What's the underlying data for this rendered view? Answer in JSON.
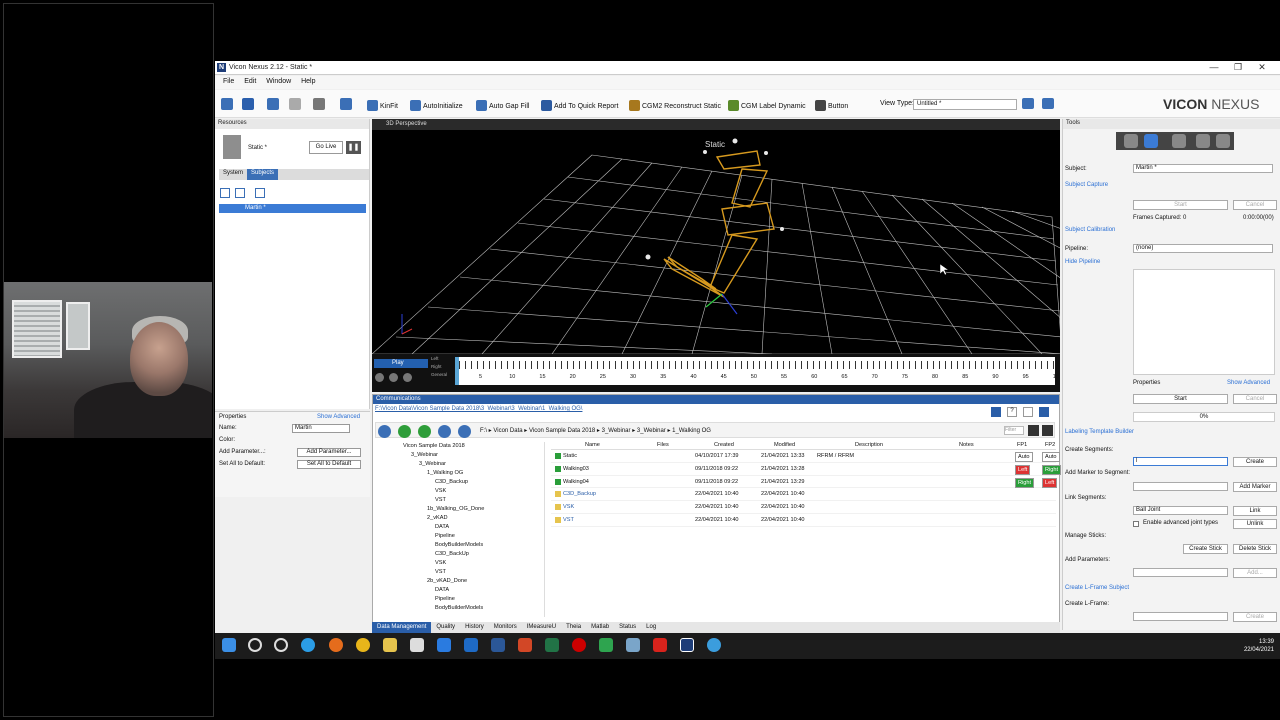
{
  "window": {
    "title": "Vicon Nexus 2.12 - Static *",
    "controls": [
      "—",
      "❐",
      "✕"
    ]
  },
  "menu": [
    "File",
    "Edit",
    "Window",
    "Help"
  ],
  "toolbar": {
    "kinfit": "KinFit",
    "autoinit": "AutoInitialize",
    "autogap": "Auto Gap Fill",
    "quickreport": "Add To Quick Report",
    "cgm2recon": "CGM2 Reconstruct Static",
    "cgmlabel": "CGM Label Dynamic",
    "button": "Button",
    "viewtype_label": "View Type:",
    "viewtype_value": "Untitled *"
  },
  "brand": {
    "vicon": "VICON",
    "nexus": "NEXUS"
  },
  "resources": {
    "title": "Resources",
    "trial": "Static *",
    "golive": "Go Live",
    "tabs": [
      "System",
      "Subjects"
    ],
    "subject": "Martin *"
  },
  "properties": {
    "title": "Properties",
    "show_advanced": "Show Advanced",
    "name_label": "Name:",
    "name_value": "Martin",
    "color_label": "Color:",
    "add_param_label": "Add Parameter...:",
    "add_param_btn": "Add Parameter...",
    "setall_label": "Set All to Default:",
    "setall_btn": "Set All to Default"
  },
  "view3d": {
    "title": "3D Perspective",
    "label": "Static"
  },
  "timeline": {
    "play": "Play",
    "rows": [
      "Left",
      "Right",
      "General"
    ],
    "ticks": [
      "5",
      "10",
      "15",
      "20",
      "25",
      "30",
      "35",
      "40",
      "45",
      "50",
      "55",
      "60",
      "65",
      "70",
      "75",
      "80",
      "85",
      "90",
      "95",
      "10"
    ]
  },
  "communications": {
    "title": "Communications",
    "path": "F:\\Vicon Data\\Vicon Sample Data 2018\\3_Webinar\\3_Webinar\\1_Walking OG\\",
    "breadcrumbs": [
      "F:\\",
      "Vicon Data",
      "Vicon Sample Data 2018",
      "3_Webinar",
      "3_Webinar",
      "1_Walking OG"
    ],
    "filter": "Filter",
    "tree": [
      {
        "indent": 1,
        "label": "Vicon Sample Data 2018"
      },
      {
        "indent": 2,
        "label": "3_Webinar"
      },
      {
        "indent": 3,
        "label": "3_Webinar"
      },
      {
        "indent": 4,
        "label": "1_Walking OG"
      },
      {
        "indent": 5,
        "label": "C3D_Backup"
      },
      {
        "indent": 5,
        "label": "VSK"
      },
      {
        "indent": 5,
        "label": "VST"
      },
      {
        "indent": 4,
        "label": "1b_Walking_OG_Done"
      },
      {
        "indent": 4,
        "label": "2_vKAD"
      },
      {
        "indent": 5,
        "label": "DATA"
      },
      {
        "indent": 5,
        "label": "Pipeline"
      },
      {
        "indent": 5,
        "label": "BodyBuilderModels"
      },
      {
        "indent": 5,
        "label": "C3D_BackUp"
      },
      {
        "indent": 5,
        "label": "VSK"
      },
      {
        "indent": 5,
        "label": "VST"
      },
      {
        "indent": 4,
        "label": "2b_vKAD_Done"
      },
      {
        "indent": 5,
        "label": "DATA"
      },
      {
        "indent": 5,
        "label": "Pipeline"
      },
      {
        "indent": 5,
        "label": "BodyBuilderModels"
      }
    ],
    "columns": [
      "Name",
      "Files",
      "Created",
      "Modified",
      "Description",
      "Notes",
      "FP1",
      "FP2"
    ],
    "rows": [
      {
        "name": "Static",
        "created": "04/10/2017 17:39",
        "modified": "21/04/2021 13:33",
        "description": "RFRM / RFRM",
        "fp1": "Auto",
        "fp2": "Auto"
      },
      {
        "name": "Walking03",
        "created": "09/11/2018 09:22",
        "modified": "21/04/2021 13:28",
        "description": "",
        "fp1": "Left",
        "fp2": "Right"
      },
      {
        "name": "Walking04",
        "created": "09/11/2018 09:22",
        "modified": "21/04/2021 13:29",
        "description": "",
        "fp1": "Right",
        "fp2": "Left"
      },
      {
        "name": "C3D_Backup",
        "created": "22/04/2021 10:40",
        "modified": "22/04/2021 10:40",
        "description": "",
        "fp1": "",
        "fp2": ""
      },
      {
        "name": "VSK",
        "created": "22/04/2021 10:40",
        "modified": "22/04/2021 10:40",
        "description": "",
        "fp1": "",
        "fp2": ""
      },
      {
        "name": "VST",
        "created": "22/04/2021 10:40",
        "modified": "22/04/2021 10:40",
        "description": "",
        "fp1": "",
        "fp2": ""
      }
    ],
    "tabs": [
      "Data Management",
      "Quality",
      "History",
      "Monitors",
      "IMeasureU",
      "Theia",
      "Matlab",
      "Status",
      "Log"
    ]
  },
  "tools": {
    "title": "Tools",
    "subject_label": "Subject:",
    "subject_value": "Martin *",
    "subject_capture": "Subject Capture",
    "start": "Start",
    "cancel": "Cancel",
    "frames_captured": "Frames Captured: 0",
    "frames_time": "0:00:00(00)",
    "subject_calibration": "Subject Calibration",
    "pipeline_label": "Pipeline:",
    "pipeline_value": "(none)",
    "hide_pipeline": "Hide Pipeline",
    "properties": "Properties",
    "show_advanced": "Show Advanced",
    "percent": "0%",
    "labeling": "Labeling Template Builder",
    "create_segments": "Create Segments:",
    "segment_value": "l",
    "create": "Create",
    "add_marker_label": "Add Marker to Segment:",
    "add_marker": "Add Marker",
    "link_segments": "Link Segments:",
    "ball_joint": "Ball Joint",
    "link": "Link",
    "advanced_joint": "Enable advanced joint types",
    "unlink": "Unlink",
    "manage_sticks": "Manage Sticks:",
    "create_stick": "Create Stick",
    "delete_stick": "Delete Stick",
    "add_parameters": "Add Parameters:",
    "add": "Add...",
    "lframe_subject": "Create L-Frame Subject",
    "create_lframe": "Create L-Frame:",
    "create_btn": "Create"
  },
  "taskbar": {
    "time": "13:39",
    "date": "22/04/2021"
  }
}
